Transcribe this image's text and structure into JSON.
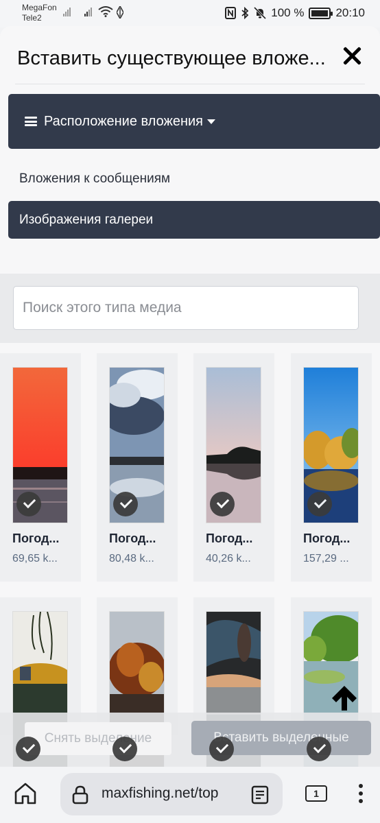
{
  "status": {
    "carrier1": "MegaFon",
    "carrier2": "Tele2",
    "battery": "100 %",
    "time": "20:10"
  },
  "modal": {
    "title": "Вставить существующее вложе..."
  },
  "location": {
    "label": "Расположение вложения"
  },
  "tabs": {
    "messages": "Вложения к сообщениям",
    "gallery": "Изображения галереи"
  },
  "search": {
    "placeholder": "Поиск этого типа медиа"
  },
  "media": [
    {
      "name": "Погод...",
      "size": "69,65 k..."
    },
    {
      "name": "Погод...",
      "size": "80,48 k..."
    },
    {
      "name": "Погод...",
      "size": "40,26 k..."
    },
    {
      "name": "Погод...",
      "size": "157,29 ..."
    }
  ],
  "actions": {
    "deselect": "Снять выделение",
    "insert": "Вставить выделенные"
  },
  "browser": {
    "url": "maxfishing.net/top",
    "tab_count": "1"
  }
}
